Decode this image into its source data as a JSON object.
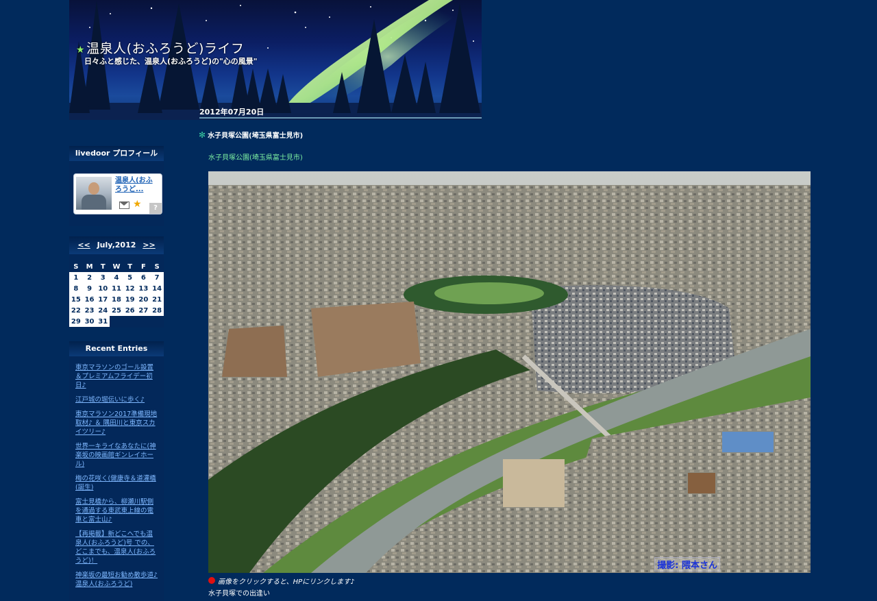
{
  "header": {
    "title": "温泉人(おふろうど)ライフ",
    "subtitle": "日々ふと感じた、温泉人(おふろうど)の\"心の風景\"",
    "title_star": "★",
    "post_date": "2012年07月20日"
  },
  "sidebar": {
    "profile": {
      "heading": "livedoor プロフィール",
      "name": "温泉人(おふろうど...",
      "help": "?"
    },
    "calendar": {
      "prev": "<<",
      "next": ">>",
      "month": "July,2012",
      "weekdays": [
        "S",
        "M",
        "T",
        "W",
        "T",
        "F",
        "S"
      ],
      "weeks": [
        [
          "1",
          "2",
          "3",
          "4",
          "5",
          "6",
          "7"
        ],
        [
          "8",
          "9",
          "10",
          "11",
          "12",
          "13",
          "14"
        ],
        [
          "15",
          "16",
          "17",
          "18",
          "19",
          "20",
          "21"
        ],
        [
          "22",
          "23",
          "24",
          "25",
          "26",
          "27",
          "28"
        ],
        [
          "29",
          "30",
          "31",
          "",
          "",
          "",
          ""
        ]
      ]
    },
    "recent": {
      "heading": "Recent Entries",
      "items": [
        "東京マラソンのゴール設置＆プレミアムフライデー初日♪",
        "江戸城の堀伝いに歩く♪",
        "東京マラソン2017準備現地取材♪ ＆ 隅田川と東京スカイツリー♪",
        "世界一キライなあなたに(神楽坂の映画館ギンレイホール)",
        "梅の花咲く(健康寺＆道灌橋(誕生)",
        "富士見橋から、柳瀬川駅側を通過する東武東上線の電車と富士山♪",
        "【再掲載】新どこへでも温泉人(おふろうど)号 での、どこまでも、温泉人(おふろうど)！",
        "神楽坂の最短お勧め散歩道♪温泉人(おふろうど)"
      ]
    }
  },
  "main": {
    "entry_mark": "✻",
    "entry_title": "水子貝塚公園(埼玉県富士見市)",
    "entry_link": "水子貝塚公園(埼玉県富士見市)",
    "photo_credit": "撮影: 隈本さん",
    "caption_click": "画像をクリックすると、HPにリンクします♪",
    "caption_sub": "水子貝塚での出逢い"
  },
  "colors": {
    "background": "#012a5c",
    "link": "#7fb8ff",
    "entry_link": "#7ef0a2",
    "accent_divider": "#6c9ab5"
  }
}
